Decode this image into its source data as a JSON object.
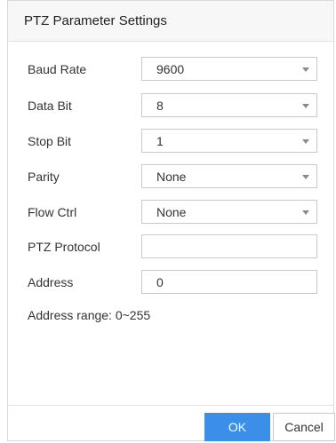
{
  "dialog": {
    "title": "PTZ Parameter Settings"
  },
  "fields": {
    "baud_rate": {
      "label": "Baud Rate",
      "value": "9600"
    },
    "data_bit": {
      "label": "Data Bit",
      "value": "8"
    },
    "stop_bit": {
      "label": "Stop Bit",
      "value": "1"
    },
    "parity": {
      "label": "Parity",
      "value": "None"
    },
    "flow_ctrl": {
      "label": "Flow Ctrl",
      "value": "None"
    },
    "ptz_protocol": {
      "label": "PTZ Protocol",
      "value": ""
    },
    "address": {
      "label": "Address",
      "value": "0"
    }
  },
  "hint": {
    "address_range": "Address range: 0~255"
  },
  "footer": {
    "ok_label": "OK",
    "cancel_label": "Cancel"
  },
  "colors": {
    "accent": "#3b8fe8",
    "header_bg": "#f7f7f7",
    "border": "#c9c9c9"
  },
  "icons": {
    "dropdown": "chevron-down-icon"
  }
}
